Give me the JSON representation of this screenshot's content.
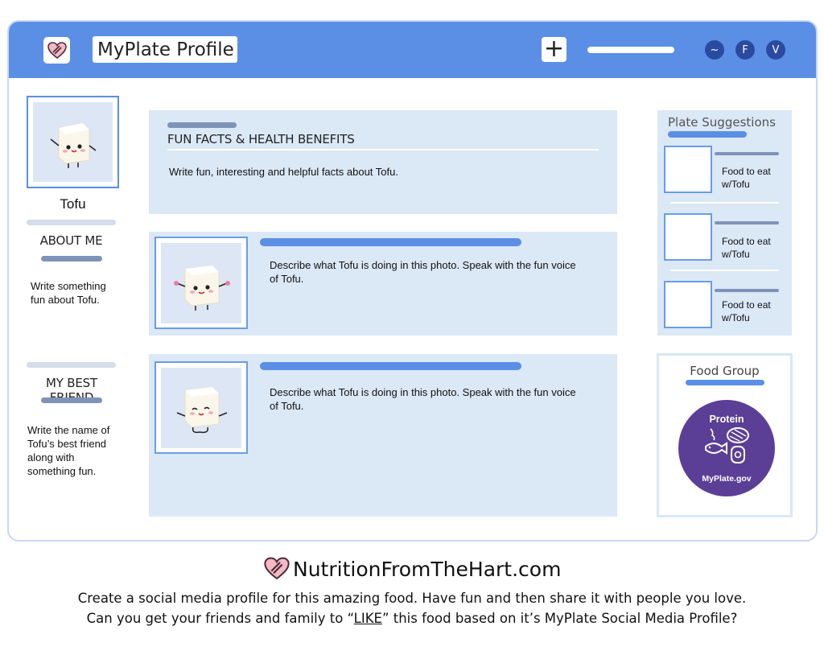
{
  "header": {
    "title": "MyPlate Profile",
    "add_label": "+",
    "buttons": [
      "~",
      "F",
      "V"
    ]
  },
  "profile": {
    "name": "Tofu",
    "about_heading": "ABOUT ME",
    "about_text": "Write something fun about Tofu.",
    "friend_heading": "MY BEST FRIEND",
    "friend_text": "Write the name of Tofu’s best friend along with something fun."
  },
  "facts": {
    "heading": "FUN FACTS & HEALTH BENEFITS",
    "text": "Write fun, interesting and helpful facts about Tofu."
  },
  "posts": [
    {
      "text": "Describe what Tofu is doing in this photo. Speak with the fun voice of Tofu."
    },
    {
      "text": "Describe what Tofu is doing in this photo. Speak with the fun voice of Tofu."
    }
  ],
  "suggestions": {
    "heading": "Plate Suggestions",
    "items": [
      {
        "label": "Food to eat w/Tofu"
      },
      {
        "label": "Food to eat w/Tofu"
      },
      {
        "label": "Food to eat w/Tofu"
      }
    ]
  },
  "food_group": {
    "heading": "Food Group",
    "badge_title": "Protein",
    "badge_site": "MyPlate.gov",
    "badge_color": "#5b3f96"
  },
  "footer": {
    "site": "NutritionFromTheHart.com",
    "line1": "Create a social media profile for this amazing food. Have fun and then share it with people you love.",
    "line2_pre": "Can you get your friends and family to “",
    "line2_like": "LIKE",
    "line2_post": "” this food based on it’s MyPlate Social Media Profile?"
  },
  "colors": {
    "accent": "#5b8fe6",
    "panel": "#dbe8f6",
    "heart": "#e89aa8"
  }
}
